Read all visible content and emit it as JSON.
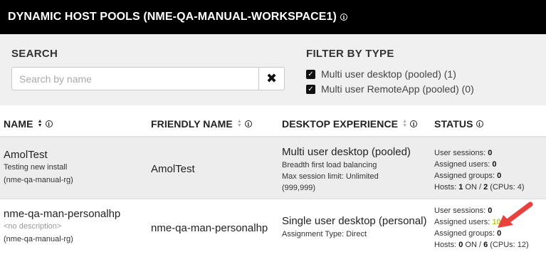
{
  "header": {
    "title": "DYNAMIC HOST POOLS (NME-QA-MANUAL-WORKSPACE1)",
    "info_icon": "info-icon"
  },
  "search": {
    "label": "SEARCH",
    "placeholder": "Search by name",
    "value": "",
    "clear_icon": "✖"
  },
  "filter": {
    "label": "FILTER BY TYPE",
    "options": [
      {
        "label": "Multi user desktop (pooled) (1)",
        "checked": true
      },
      {
        "label": "Multi user RemoteApp (pooled) (0)",
        "checked": true
      }
    ]
  },
  "columns": {
    "name": "NAME",
    "friendly_name": "FRIENDLY NAME",
    "desktop_experience": "DESKTOP EXPERIENCE",
    "status": "STATUS"
  },
  "rows": [
    {
      "name": "AmolTest",
      "description": "Testing new install",
      "resource_group": "(nme-qa-manual-rg)",
      "friendly_name": "AmolTest",
      "experience": "Multi user desktop (pooled)",
      "experience_details": [
        "Breadth first load balancing",
        "Max session limit: Unlimited",
        "(999,999)"
      ],
      "status": {
        "sessions_label": "User sessions: ",
        "sessions": "0",
        "assigned_users_label": "Assigned users: ",
        "assigned_users": "0",
        "assigned_groups_label": "Assigned groups: ",
        "assigned_groups": "0",
        "hosts_label": "Hosts: ",
        "hosts_on": "1",
        "on_label": " ON / ",
        "hosts_total": "2",
        "cpus": " (CPUs: 4)"
      }
    },
    {
      "name": "nme-qa-man-personalhp",
      "description": "<no description>",
      "resource_group": "(nme-qa-manual-rg)",
      "friendly_name": "nme-qa-man-personalhp",
      "experience": "Single user desktop (personal)",
      "experience_details": [
        "Assignment Type: Direct"
      ],
      "status": {
        "sessions_label": "User sessions: ",
        "sessions": "0",
        "assigned_users_label": "Assigned users: ",
        "assigned_users": "10",
        "assigned_groups_label": "Assigned groups: ",
        "assigned_groups": "0",
        "hosts_label": "Hosts: ",
        "hosts_on": "0",
        "on_label": " ON / ",
        "hosts_total": "6",
        "cpus": " (CPUs: 12)"
      }
    }
  ],
  "colors": {
    "header_bg": "#000000",
    "highlight": "#b5c83a",
    "annotation_arrow": "#e8423f"
  }
}
